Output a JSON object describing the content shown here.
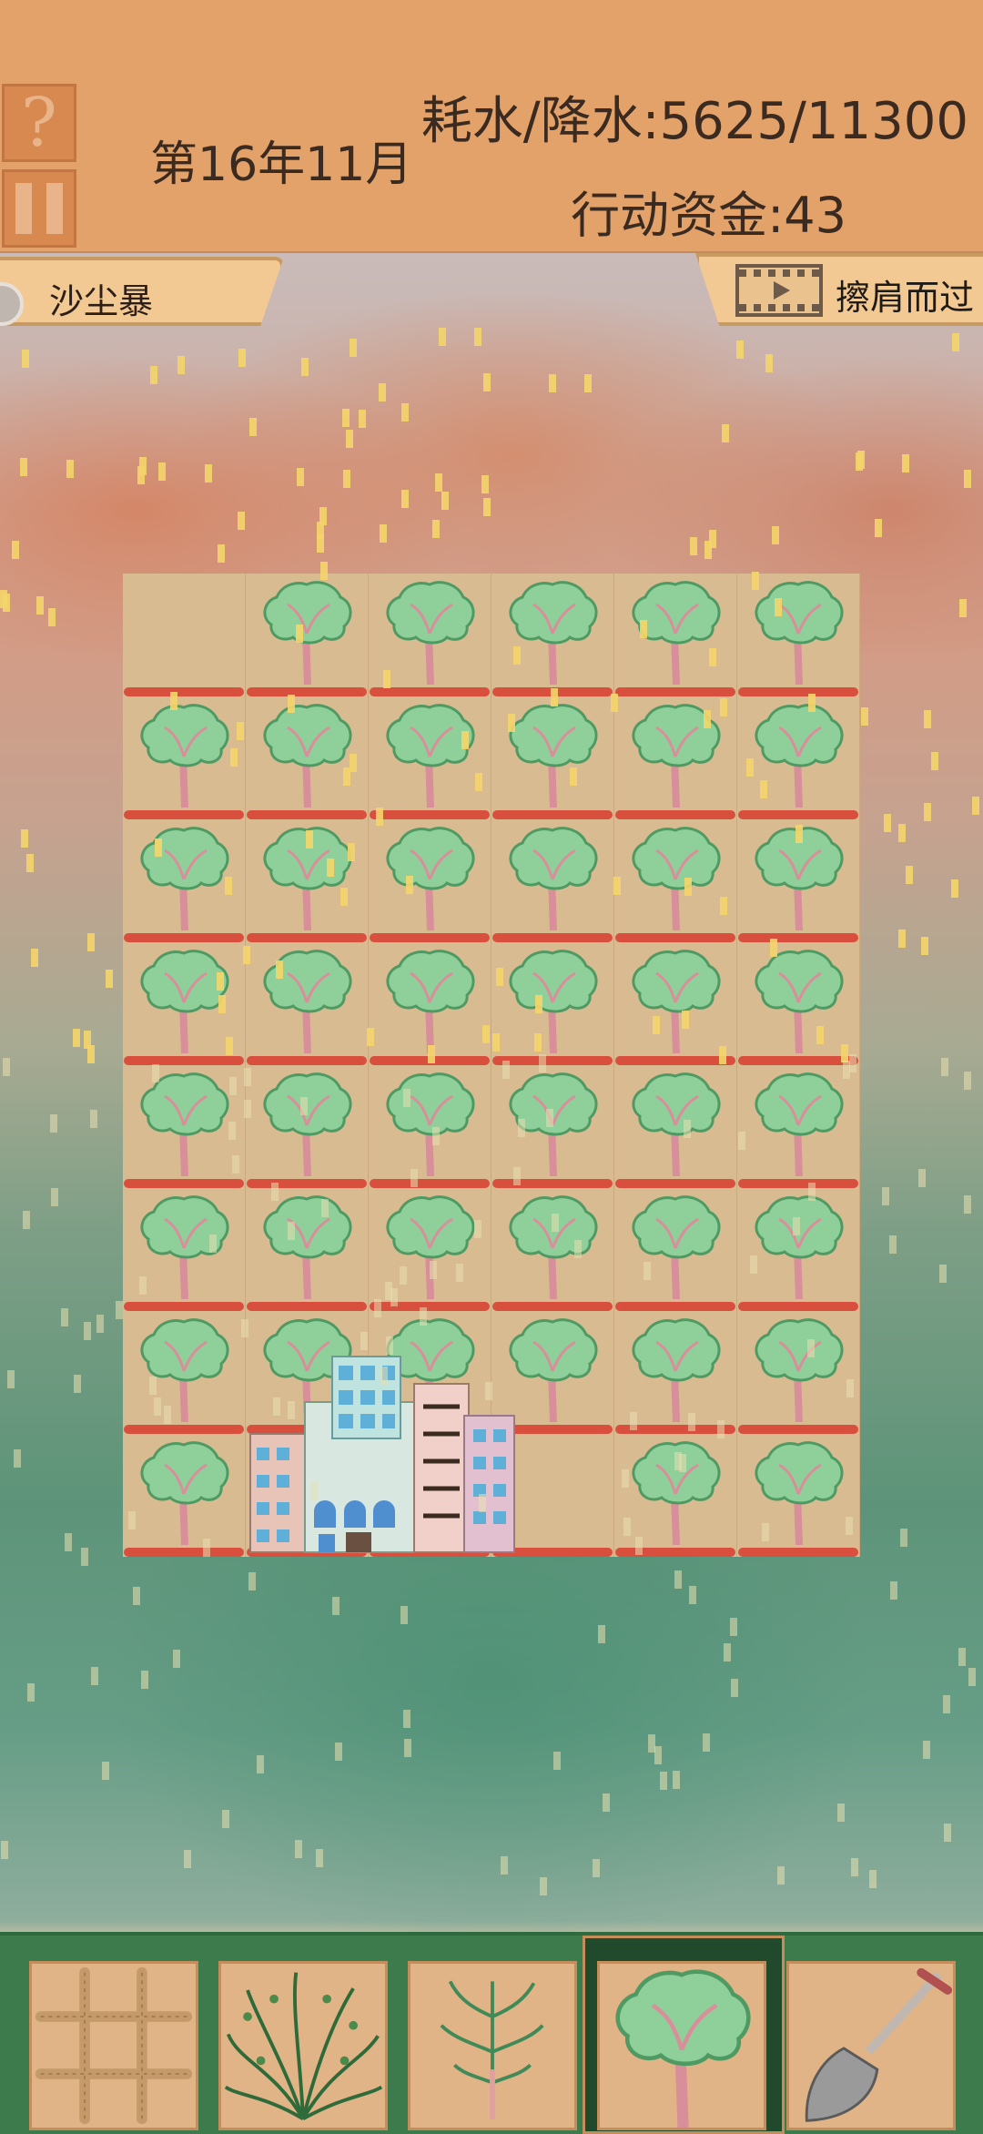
{
  "header": {
    "help_label": "?",
    "date": "第16年11月",
    "water": "耗水/降水:5625/11300",
    "funds": "行动资金:43"
  },
  "event": {
    "left_label": "沙尘暴",
    "right_label": "擦肩而过"
  },
  "board": {
    "rows": 8,
    "cols": 6,
    "empty_tile": "row-1-col-1",
    "building": "city-buildings-icon",
    "tile_icon": "tree-icon"
  },
  "toolbar": {
    "tools": [
      "straw-grid-icon",
      "shrub-icon",
      "sapling-icon",
      "tree-icon",
      "shovel-icon"
    ],
    "selected": "tree-icon"
  },
  "colors": {
    "header_bg": "#e2a26a",
    "water_bar": "#d84f3e",
    "toolbar_bg": "#3d7a4c",
    "dust": "#f4d56a"
  }
}
